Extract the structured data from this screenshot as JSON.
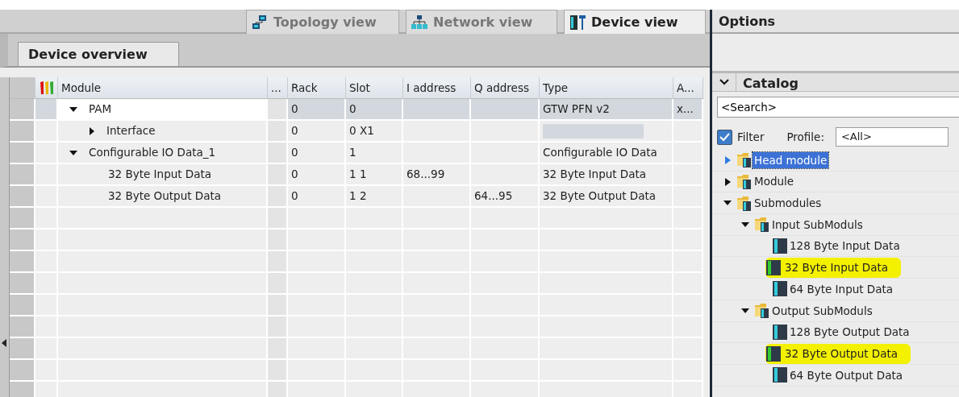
{
  "view_tabs": [
    {
      "label": "Topology view",
      "kind": "topology",
      "selected": false
    },
    {
      "label": "Network view",
      "kind": "network",
      "selected": false
    },
    {
      "label": "Device view",
      "kind": "device",
      "selected": true
    }
  ],
  "overview_tab": {
    "label": "Device overview",
    "selected": true
  },
  "table": {
    "columns": [
      "Module",
      "...",
      "Rack",
      "Slot",
      "I address",
      "Q address",
      "Type",
      "A..."
    ],
    "rows": [
      {
        "module": "PAM",
        "expanded": true,
        "selected": true,
        "rack": "0",
        "slot": "0",
        "i_address": "",
        "q_address": "",
        "type": "GTW PFN v2",
        "column_8": "x...",
        "children": [
          {
            "module": "Interface",
            "expanded": false,
            "selected": false,
            "rack": "0",
            "slot": "0 X1",
            "type_blank": true
          }
        ]
      },
      {
        "module": "Configurable IO Data_1",
        "expanded": true,
        "selected": false,
        "rack": "0",
        "slot": "1",
        "type": "Configurable IO Data",
        "children": [
          {
            "module": "32 Byte Input Data",
            "selected": false,
            "rack": "0",
            "slot": "1 1",
            "i_address": "68...99",
            "type": "32 Byte Input Data"
          },
          {
            "module": "32 Byte Output Data",
            "selected": false,
            "rack": "0",
            "slot": "1 2",
            "q_address": "64...95",
            "type": "32 Byte Output Data"
          }
        ]
      }
    ]
  },
  "options": {
    "title": "Options"
  },
  "catalog": {
    "title": "Catalog",
    "expanded": true,
    "search": {
      "value": "<Search>"
    },
    "filter": {
      "label": "Filter",
      "checked": true
    },
    "profile": {
      "label": "Profile:",
      "value": "<All>"
    },
    "tree": [
      {
        "label": "Head module",
        "kind": "folder",
        "expanded": false,
        "selected": true
      },
      {
        "label": "Module",
        "kind": "folder",
        "expanded": false,
        "selected": false
      },
      {
        "label": "Submodules",
        "kind": "folder",
        "expanded": true,
        "selected": false,
        "children": [
          {
            "label": "Input SubModuls",
            "kind": "folder",
            "expanded": true,
            "selected": false,
            "children": [
              {
                "label": "128 Byte Input Data",
                "kind": "module",
                "selected": false,
                "highlighted": false
              },
              {
                "label": "32 Byte Input Data",
                "kind": "module",
                "selected": false,
                "highlighted": true
              },
              {
                "label": "64 Byte Input Data",
                "kind": "module",
                "selected": false,
                "highlighted": false
              }
            ]
          },
          {
            "label": "Output SubModuls",
            "kind": "folder",
            "expanded": true,
            "selected": false,
            "children": [
              {
                "label": "128 Byte Output Data",
                "kind": "module",
                "selected": false,
                "highlighted": false
              },
              {
                "label": "32 Byte Output Data",
                "kind": "module",
                "selected": false,
                "highlighted": true
              },
              {
                "label": "64 Byte Output Data",
                "kind": "module",
                "selected": false,
                "highlighted": false
              }
            ]
          }
        ]
      }
    ]
  }
}
